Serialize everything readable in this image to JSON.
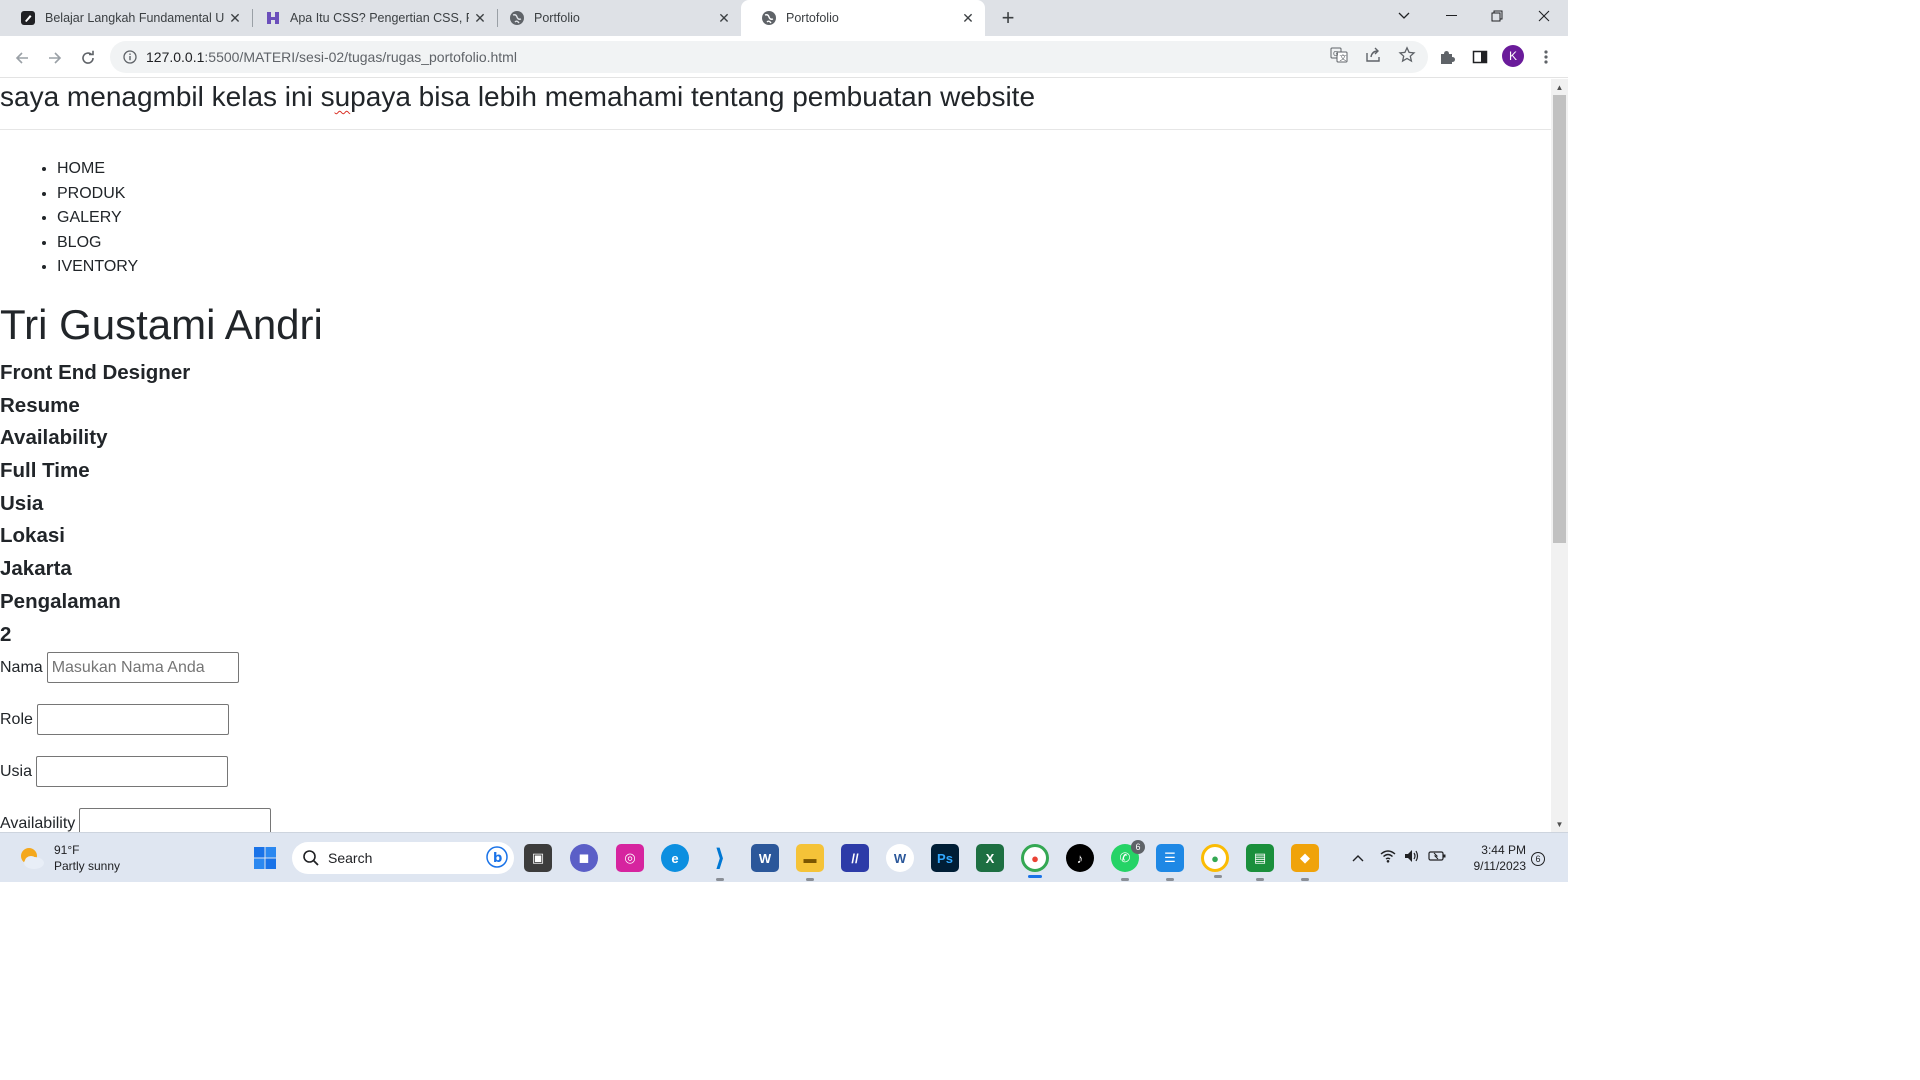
{
  "browser": {
    "tabs": [
      {
        "title": "Belajar Langkah Fundamental Un",
        "favicon": "pen-icon"
      },
      {
        "title": "Apa Itu CSS? Pengertian CSS, Fur",
        "favicon": "h-logo-icon"
      },
      {
        "title": "Portfolio",
        "favicon": "globe-icon"
      },
      {
        "title": "Portofolio",
        "favicon": "globe-icon",
        "active": true
      }
    ],
    "url_host": "127.0.0.1",
    "url_path": ":5500/MATERI/sesi-02/tugas/rugas_portofolio.html",
    "profile_initial": "K"
  },
  "page": {
    "header_before": "saya menagmbil kelas ini s",
    "header_misspelled": "u",
    "header_after": "paya bisa lebih memahami tentang pembuatan website",
    "nav": [
      "HOME",
      "PRODUK",
      "GALERY",
      "BLOG",
      "IVENTORY"
    ],
    "name": "Tri Gustami Andri",
    "info": [
      "Front End Designer",
      "Resume",
      "Availability",
      "Full Time",
      "Usia",
      "Lokasi",
      "Jakarta",
      "Pengalaman",
      "2"
    ],
    "form": {
      "nama_label": "Nama",
      "nama_placeholder": "Masukan Nama Anda",
      "role_label": "Role",
      "usia_label": "Usia",
      "availability_label": "Availability"
    }
  },
  "taskbar": {
    "weather_temp": "91°F",
    "weather_desc": "Partly sunny",
    "search_label": "Search",
    "time": "3:44 PM",
    "date": "9/11/2023",
    "whatsapp_badge": "6",
    "notifications": "6"
  },
  "colors": {
    "tabstrip": "#dee1e6",
    "profile": "#6a1b9a",
    "taskbar": "#dfe6f1"
  }
}
